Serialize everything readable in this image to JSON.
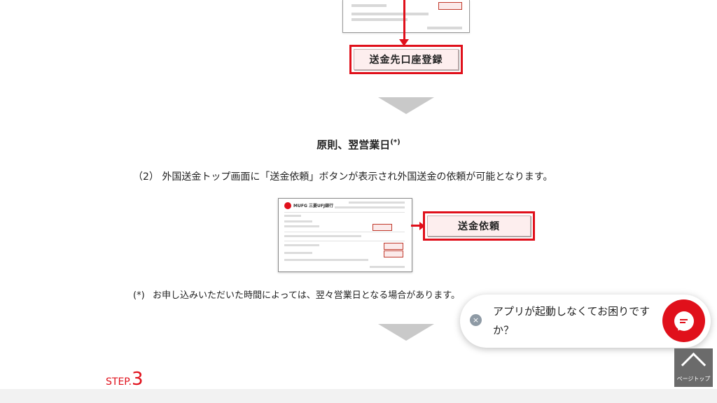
{
  "top_button": {
    "label": "送金先口座登録"
  },
  "heading": {
    "text": "原則、翌営業日",
    "sup": "(*)"
  },
  "step_text": "（2） 外国送金トップ画面に「送金依頼」ボタンが表示され外国送金の依頼が可能となります。",
  "screenshot": {
    "logo_text": "MUFG 三菱UFJ銀行"
  },
  "action_button": {
    "label": "送金依頼"
  },
  "note": {
    "mark": "(*)",
    "text": "お申し込みいただいた時間によっては、翌々営業日となる場合があります。"
  },
  "chat": {
    "text": "アプリが起動しなくてお困りですか？",
    "close_symbol": "×",
    "chat_icon": "chat-bubble-icon"
  },
  "page_top": {
    "label": "ページトップ",
    "icon": "chevron-up-icon"
  },
  "step": {
    "prefix": "STEP.",
    "number": "3"
  },
  "colors": {
    "accent": "#e0101b",
    "arrow_gray": "#c9c9c9",
    "page_top_bg": "#6b6b6b"
  }
}
